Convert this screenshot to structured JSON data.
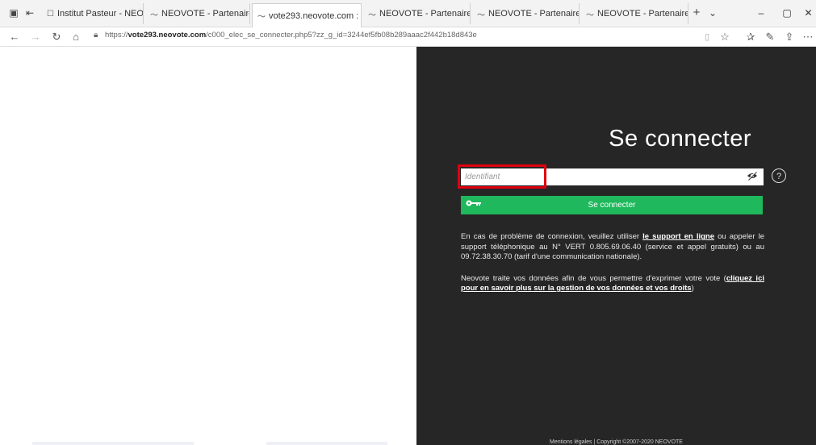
{
  "browser": {
    "tabs": [
      {
        "label": "Institut Pasteur - NEOVOTE-",
        "favicon": "page-icon",
        "active": false
      },
      {
        "label": "NEOVOTE - Partenaire de vc",
        "favicon": "neovote-icon",
        "active": false
      },
      {
        "label": "vote293.neovote.com :",
        "favicon": "neovote-icon",
        "active": true,
        "close": "✕"
      },
      {
        "label": "NEOVOTE - Partenaire de vc",
        "favicon": "neovote-icon",
        "active": false
      },
      {
        "label": "NEOVOTE - Partenaire de vc",
        "favicon": "neovote-icon",
        "active": false
      },
      {
        "label": "NEOVOTE - Partenaire de vc",
        "favicon": "neovote-icon",
        "active": false
      }
    ],
    "new_tab": "+",
    "tab_menu": "⌄",
    "url_prefix": "https://",
    "url_host": "vote293.neovote.com",
    "url_path": "/c000_elec_se_connecter.php5?zz_g_id=3244ef5fb08b289aaac2f442b18d843e"
  },
  "login": {
    "title": "Se connecter",
    "identifier_placeholder": "Identifiant",
    "identifier_value": "",
    "submit_label": "Se connecter",
    "help_symbol": "?"
  },
  "info": {
    "p1_before": "En cas de problème de connexion, veuillez utiliser ",
    "p1_link": "le support en ligne",
    "p1_after": " ou appeler le support téléphonique au N° VERT 0.805.69.06.40 (service et appel gratuits) ou au 09.72.38.30.70 (tarif d'une communication nationale).",
    "p2_before": "Neovote traite vos données afin de vous permettre d'exprimer votre vote (",
    "p2_link": "cliquez ici pour en savoir plus sur la gestion de vos données et vos droits",
    "p2_after": ")"
  },
  "footer": {
    "text": "Mentions légales | Copyright ©2007-2020 NEOVOTE"
  },
  "colors": {
    "panel_bg": "#262626",
    "submit_bg": "#1fb85c",
    "highlight": "#e0000f"
  }
}
